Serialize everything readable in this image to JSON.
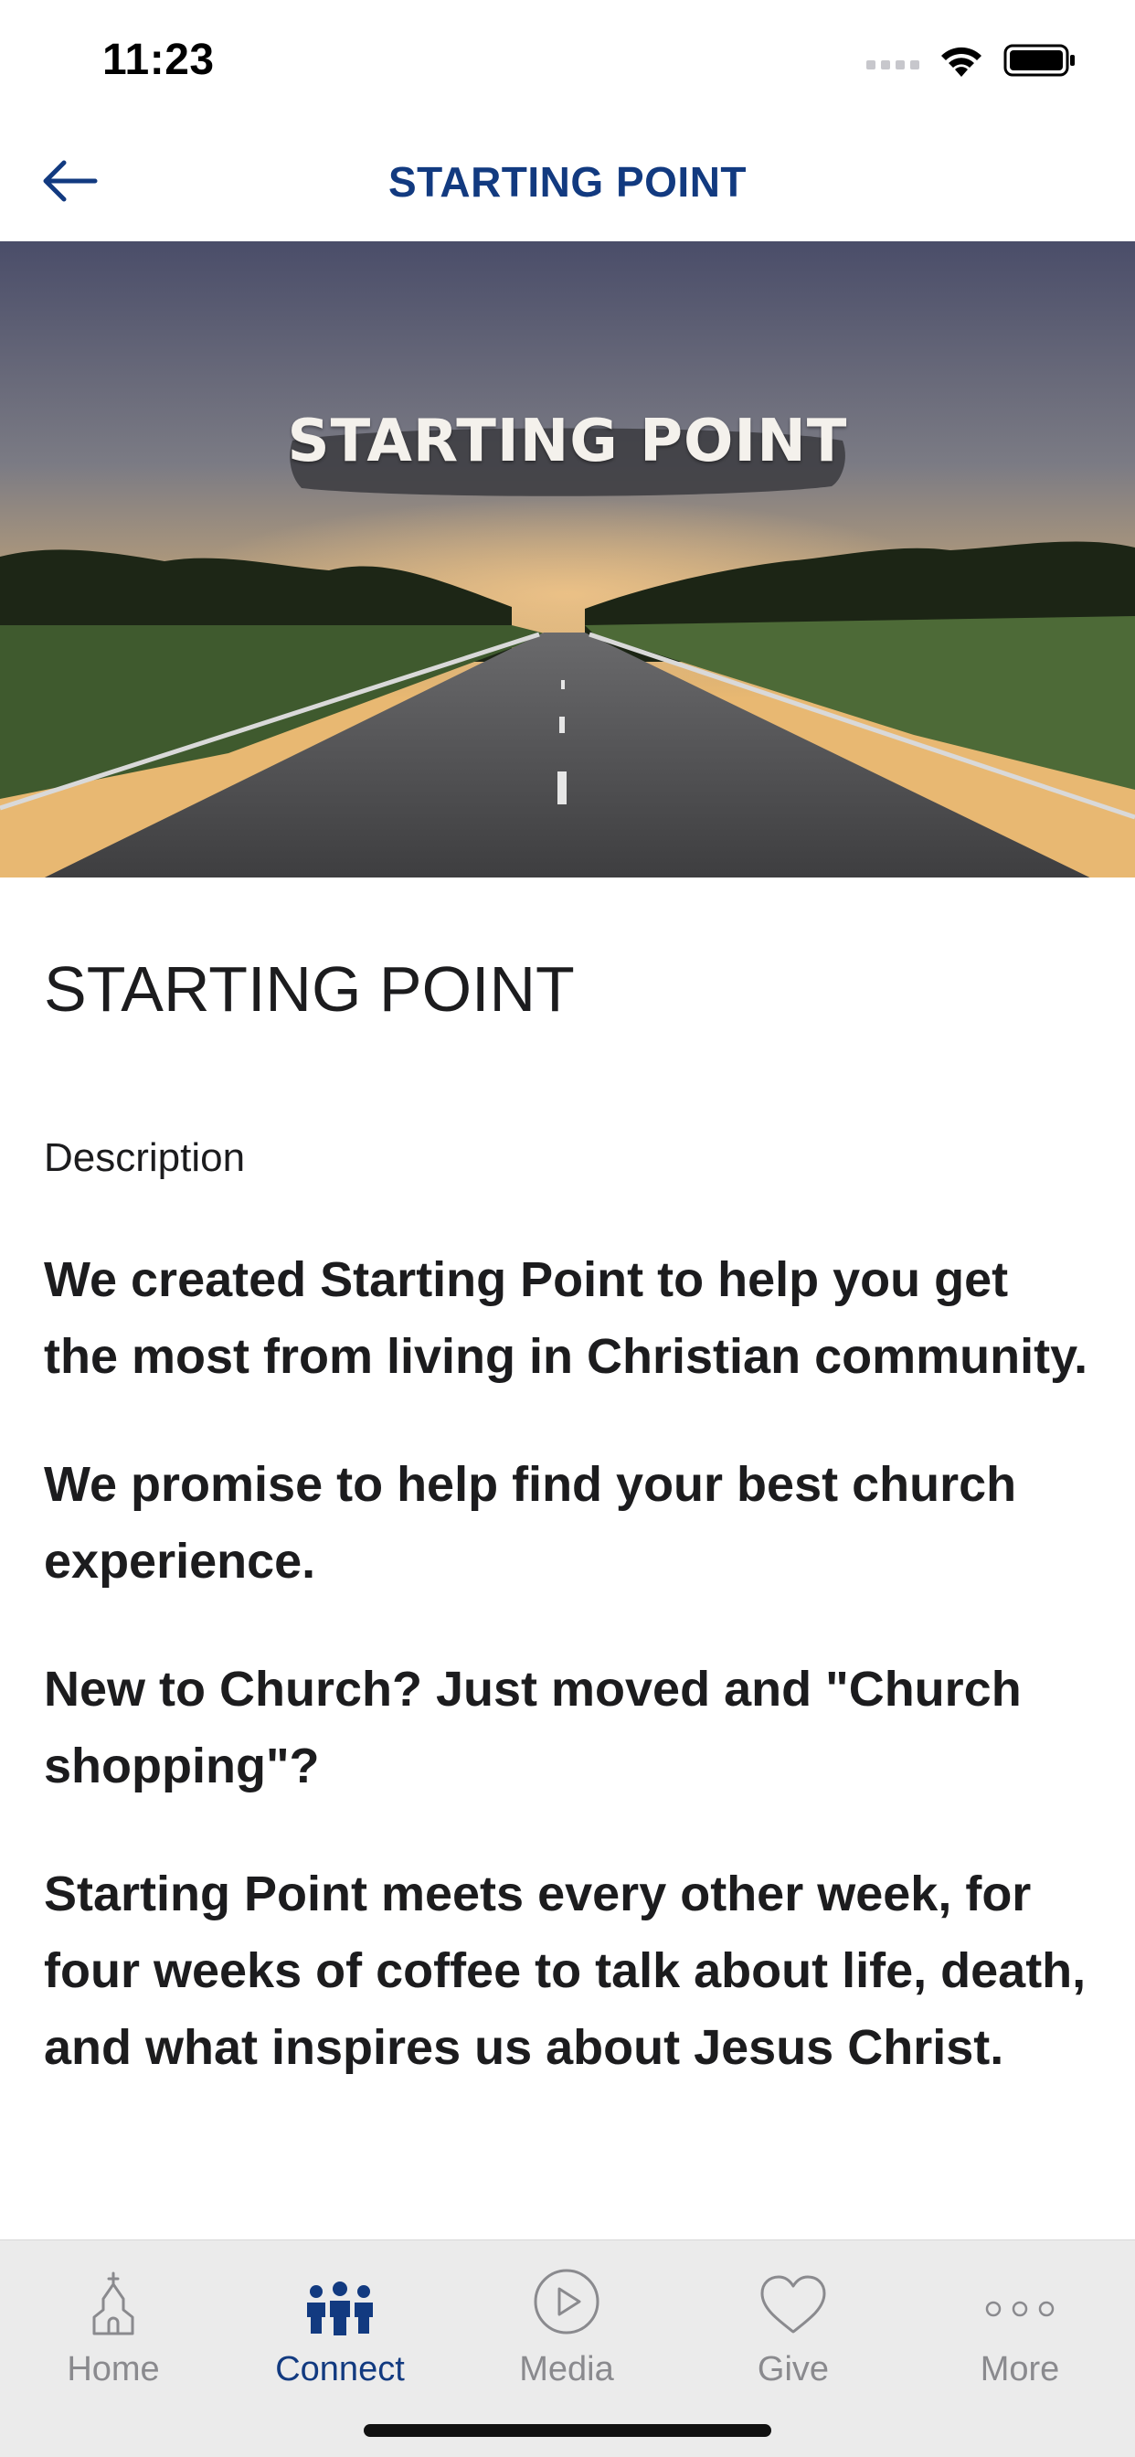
{
  "status_bar": {
    "time": "11:23"
  },
  "nav": {
    "title": "STARTING POINT"
  },
  "hero": {
    "overlay_text": "STARTING POINT"
  },
  "content": {
    "heading": "STARTING POINT",
    "description_label": "Description",
    "paragraphs": [
      "We created Starting Point to help you get the most from living in Christian community.",
      "We promise to help find your best church experience.",
      "New to Church? Just moved and \"Church shopping\"?",
      "Starting Point meets every other week, for four weeks of coffee to talk about life, death, and what inspires us about Jesus Christ."
    ]
  },
  "tabs": [
    {
      "label": "Home",
      "icon": "church-icon",
      "active": false
    },
    {
      "label": "Connect",
      "icon": "people-icon",
      "active": true
    },
    {
      "label": "Media",
      "icon": "play-icon",
      "active": false
    },
    {
      "label": "Give",
      "icon": "heart-icon",
      "active": false
    },
    {
      "label": "More",
      "icon": "more-dots-icon",
      "active": false
    }
  ],
  "colors": {
    "accent": "#123a80",
    "tab_inactive": "#8a8a8e",
    "tab_bar_bg": "#ebebeb"
  }
}
